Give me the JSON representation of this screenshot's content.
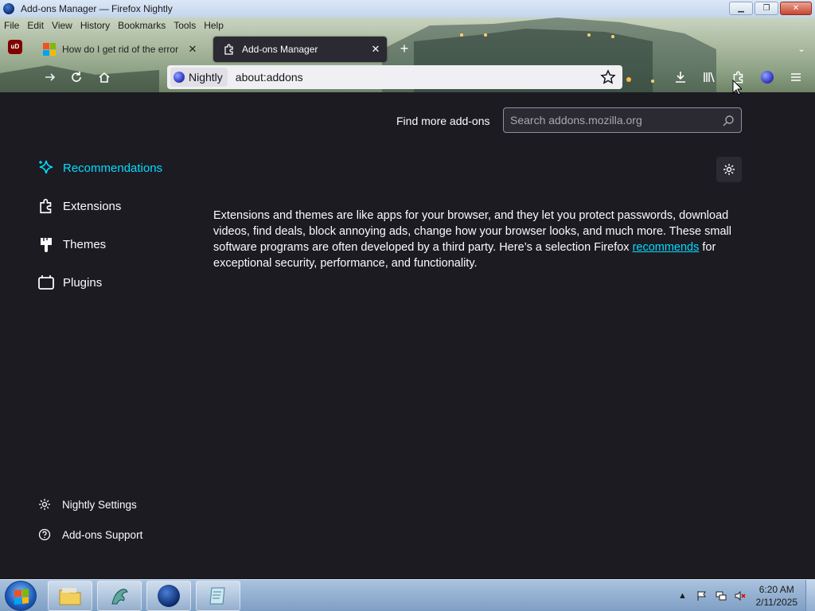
{
  "window": {
    "title": "Add-ons Manager — Firefox Nightly",
    "minimize": "▁",
    "maximize": "❐",
    "close": "✕"
  },
  "menubar": {
    "items": [
      {
        "label": "File",
        "key": "F"
      },
      {
        "label": "Edit",
        "key": "E"
      },
      {
        "label": "View",
        "key": "V"
      },
      {
        "label": "History",
        "key": "H"
      },
      {
        "label": "Bookmarks",
        "key": "B"
      },
      {
        "label": "Tools",
        "key": "T"
      },
      {
        "label": "Help",
        "key": "H"
      }
    ]
  },
  "tabs": {
    "extension_badge": "uD",
    "inactive": {
      "label": "How do I get rid of the error",
      "close": "✕"
    },
    "active": {
      "label": "Add-ons Manager",
      "close": "✕"
    },
    "new_tab": "+",
    "list_all": "⌄"
  },
  "urlbar": {
    "identity_label": "Nightly",
    "url": "about:addons"
  },
  "page": {
    "find_more_label": "Find more add-ons",
    "search_placeholder": "Search addons.mozilla.org",
    "categories": [
      {
        "label": "Recommendations",
        "selected": true
      },
      {
        "label": "Extensions",
        "selected": false
      },
      {
        "label": "Themes",
        "selected": false
      },
      {
        "label": "Plugins",
        "selected": false
      }
    ],
    "intro_before_link": "Extensions and themes are like apps for your browser, and they let you protect passwords, download videos, find deals, block annoying ads, change how your browser looks, and much more. These small software programs are often developed by a third party. Here’s a selection Firefox ",
    "intro_link": "recommends",
    "intro_after_link": " for exceptional security, performance, and functionality.",
    "footer": {
      "settings_label": "Nightly Settings",
      "support_label": "Add-ons Support"
    }
  },
  "taskbar": {
    "time": "6:20 AM",
    "date": "2/11/2025"
  },
  "colors": {
    "accent": "#00ddff",
    "page_bg": "#1c1b22",
    "tab_active_bg": "#2b2a33",
    "text": "#fbfbfe"
  }
}
